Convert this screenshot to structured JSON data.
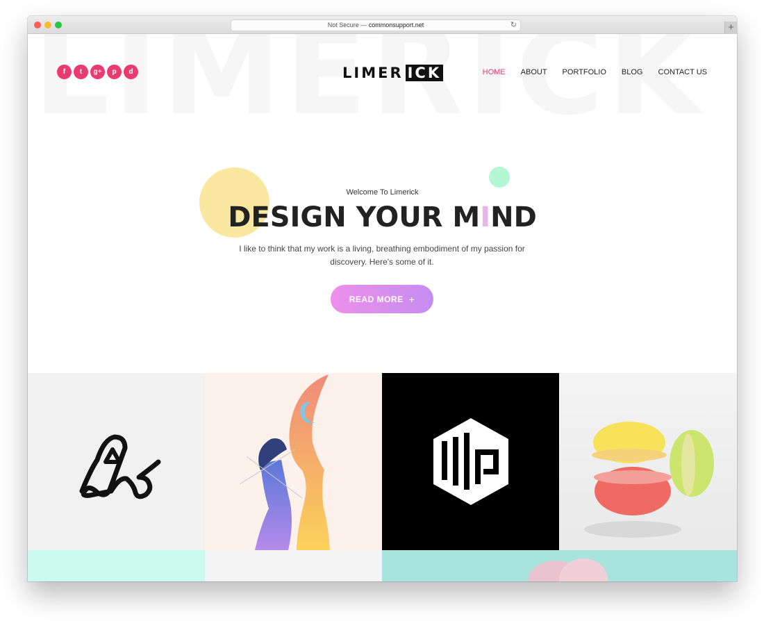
{
  "browser": {
    "url_prefix": "Not Secure —",
    "url_domain": "commonsupport.net",
    "new_tab_label": "+"
  },
  "background_word": "LIMERICK",
  "socials": [
    {
      "icon": "facebook-icon",
      "glyph": "f"
    },
    {
      "icon": "twitter-icon",
      "glyph": "t"
    },
    {
      "icon": "google-plus-icon",
      "glyph": "g+"
    },
    {
      "icon": "pinterest-icon",
      "glyph": "p"
    },
    {
      "icon": "dribbble-icon",
      "glyph": "d"
    }
  ],
  "logo": {
    "part1": "LIMER",
    "part2": "ICK"
  },
  "nav": {
    "home": "HOME",
    "about": "ABOUT",
    "portfolio": "PORTFOLIO",
    "blog": "BLOG",
    "contact": "CONTACT US"
  },
  "hero": {
    "welcome": "Welcome To Limerick",
    "headline_a": "DESIGN YOUR M",
    "headline_i": "I",
    "headline_b": "ND",
    "subtitle": "I like to think that my work is a living, breathing embodiment of my passion for discovery. Here's some of it.",
    "button": "READ MORE",
    "button_icon": "+"
  },
  "colors": {
    "accent": "#ea3a70",
    "button_start": "#ee8fea",
    "button_end": "#c58df0",
    "yellow_circle": "#fae8a0",
    "green_circle": "#b4f7d3"
  }
}
